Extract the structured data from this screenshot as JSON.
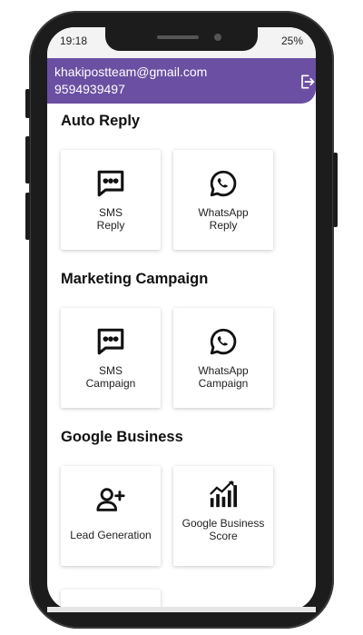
{
  "status": {
    "time": "19:18",
    "battery": "25%"
  },
  "header": {
    "email": "khakipostteam@gmail.com",
    "phone": "9594939497"
  },
  "sections": [
    {
      "title": "Auto Reply",
      "cards": [
        {
          "line1": "SMS",
          "line2": "Reply",
          "icon": "sms-icon"
        },
        {
          "line1": "WhatsApp",
          "line2": "Reply",
          "icon": "whatsapp-icon"
        }
      ]
    },
    {
      "title": "Marketing Campaign",
      "cards": [
        {
          "line1": "SMS",
          "line2": "Campaign",
          "icon": "sms-icon"
        },
        {
          "line1": "WhatsApp",
          "line2": "Campaign",
          "icon": "whatsapp-icon"
        }
      ]
    },
    {
      "title": "Google Business",
      "cards": [
        {
          "line1": "Lead Generation",
          "line2": "",
          "icon": "add-user-icon"
        },
        {
          "line1": "Google Business",
          "line2": "Score",
          "icon": "chart-growth-icon"
        }
      ]
    }
  ],
  "colors": {
    "header": "#6b4fa2",
    "phone_frame": "#1c1c1c"
  }
}
